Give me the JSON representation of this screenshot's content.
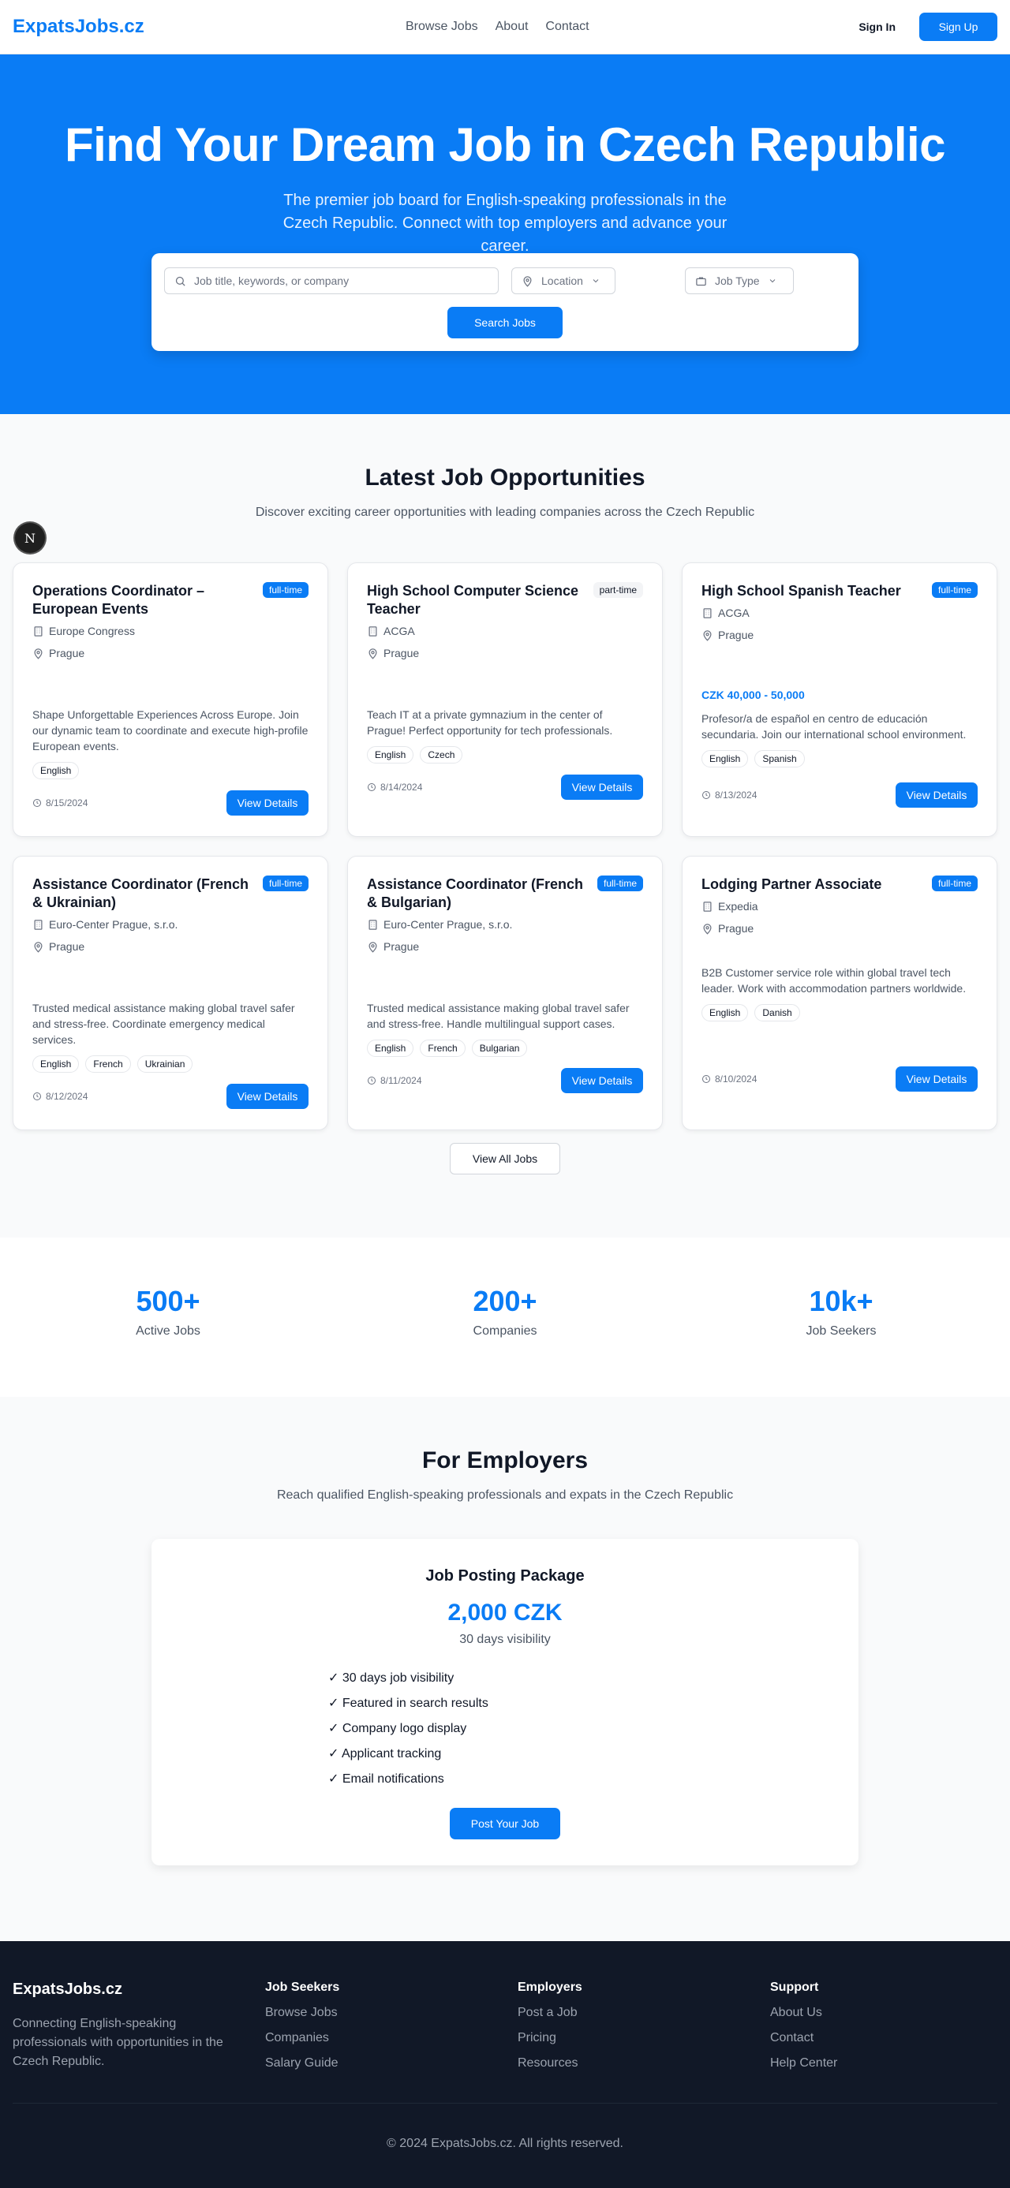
{
  "nav": {
    "logo": "ExpatsJobs.cz",
    "links": [
      "Browse Jobs",
      "About",
      "Contact"
    ],
    "sign_in": "Sign In",
    "sign_up": "Sign Up"
  },
  "hero": {
    "title": "Find Your Dream Job in Czech Republic",
    "subtitle": "The premier job board for English-speaking professionals in the Czech Republic. Connect with top employers and advance your career.",
    "search": {
      "keyword_placeholder": "Job title, keywords, or company",
      "location_label": "Location",
      "job_type_label": "Job Type",
      "button": "Search Jobs"
    }
  },
  "latest": {
    "title": "Latest Job Opportunities",
    "subtitle": "Discover exciting career opportunities with leading companies across the Czech Republic",
    "badge_letter": "N",
    "view_all": "View All Jobs",
    "view_details": "View Details",
    "jobs": [
      {
        "title": "Operations Coordinator – European Events",
        "type": "full-time",
        "company": "Europe Congress",
        "location": "Prague",
        "salary": "",
        "description": "Shape Unforgettable Experiences Across Europe. Join our dynamic team to coordinate and execute high-profile European events.",
        "tags": [
          "English"
        ],
        "date": "8/15/2024"
      },
      {
        "title": "High School Computer Science Teacher",
        "type": "part-time",
        "company": "ACGA",
        "location": "Prague",
        "salary": "",
        "description": "Teach IT at a private gymnazium in the center of Prague! Perfect opportunity for tech professionals.",
        "tags": [
          "English",
          "Czech"
        ],
        "date": "8/14/2024"
      },
      {
        "title": "High School Spanish Teacher",
        "type": "full-time",
        "company": "ACGA",
        "location": "Prague",
        "salary": "CZK 40,000 - 50,000",
        "description": "Profesor/a de español en centro de educación secundaria. Join our international school environment.",
        "tags": [
          "English",
          "Spanish"
        ],
        "date": "8/13/2024"
      },
      {
        "title": "Assistance Coordinator (French & Ukrainian)",
        "type": "full-time",
        "company": "Euro-Center Prague, s.r.o.",
        "location": "Prague",
        "salary": "",
        "description": "Trusted medical assistance making global travel safer and stress-free. Coordinate emergency medical services.",
        "tags": [
          "English",
          "French",
          "Ukrainian"
        ],
        "date": "8/12/2024"
      },
      {
        "title": "Assistance Coordinator (French & Bulgarian)",
        "type": "full-time",
        "company": "Euro-Center Prague, s.r.o.",
        "location": "Prague",
        "salary": "",
        "description": "Trusted medical assistance making global travel safer and stress-free. Handle multilingual support cases.",
        "tags": [
          "English",
          "French",
          "Bulgarian"
        ],
        "date": "8/11/2024"
      },
      {
        "title": "Lodging Partner Associate",
        "type": "full-time",
        "company": "Expedia",
        "location": "Prague",
        "salary": "",
        "description": "B2B Customer service role within global travel tech leader. Work with accommodation partners worldwide.",
        "tags": [
          "English",
          "Danish"
        ],
        "date": "8/10/2024"
      }
    ]
  },
  "stats": [
    {
      "value": "500+",
      "label": "Active Jobs"
    },
    {
      "value": "200+",
      "label": "Companies"
    },
    {
      "value": "10k+",
      "label": "Job Seekers"
    }
  ],
  "employers": {
    "title": "For Employers",
    "subtitle": "Reach qualified English-speaking professionals and expats in the Czech Republic",
    "package": {
      "title": "Job Posting Package",
      "price": "2,000 CZK",
      "duration": "30 days visibility",
      "features": [
        "✓ 30 days job visibility",
        "✓ Featured in search results",
        "✓ Company logo display",
        "✓ Applicant tracking",
        "✓ Email notifications"
      ],
      "button": "Post Your Job"
    }
  },
  "footer": {
    "brand": "ExpatsJobs.cz",
    "description": "Connecting English-speaking professionals with opportunities in the Czech Republic.",
    "columns": [
      {
        "heading": "Job Seekers",
        "links": [
          "Browse Jobs",
          "Companies",
          "Salary Guide"
        ]
      },
      {
        "heading": "Employers",
        "links": [
          "Post a Job",
          "Pricing",
          "Resources"
        ]
      },
      {
        "heading": "Support",
        "links": [
          "About Us",
          "Contact",
          "Help Center"
        ]
      }
    ],
    "copyright": "© 2024 ExpatsJobs.cz. All rights reserved."
  },
  "colors": {
    "brand": "#0a7cf5",
    "footer_bg": "#111827",
    "section_bg": "#f9fafb"
  }
}
